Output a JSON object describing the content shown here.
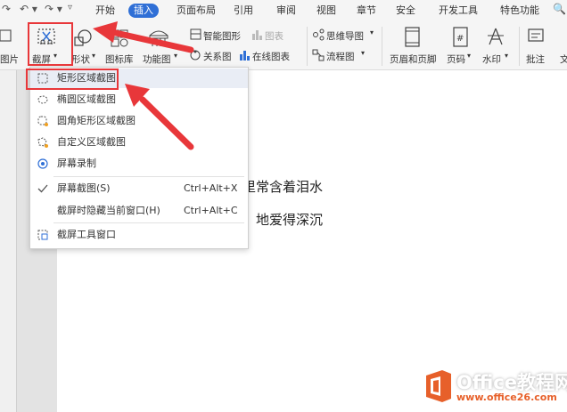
{
  "menubar": {
    "tabs": [
      "开始",
      "插入",
      "页面布局",
      "引用",
      "审阅",
      "视图",
      "章节",
      "安全",
      "开发工具",
      "特色功能"
    ],
    "active_tab": "插入"
  },
  "ribbon": {
    "pic_partial": "图片",
    "screenshot": "截屏",
    "shapes": "形状",
    "icon_lib": "图标库",
    "func_chart": "功能图",
    "smart_shape": "智能图形",
    "chart": "图表",
    "relation": "关系图",
    "online_chart": "在线图表",
    "mindmap": "思维导图",
    "flowchart": "流程图",
    "header_footer": "页眉和页脚",
    "page_number": "页码",
    "watermark": "水印",
    "comment": "批注",
    "text_partial": "文"
  },
  "dropdown": {
    "items": [
      {
        "label": "矩形区域截图",
        "shortcut": "",
        "icon": "rect-select-icon"
      },
      {
        "label": "椭圆区域截图",
        "shortcut": "",
        "icon": "ellipse-select-icon"
      },
      {
        "label": "圆角矩形区域截图",
        "shortcut": "",
        "icon": "rounded-rect-select-icon"
      },
      {
        "label": "自定义区域截图",
        "shortcut": "",
        "icon": "custom-select-icon"
      },
      {
        "label": "屏幕录制",
        "shortcut": "",
        "icon": "screen-record-icon"
      },
      {
        "label": "屏幕截图(S)",
        "shortcut": "Ctrl+Alt+X",
        "icon": "check-icon"
      },
      {
        "label": "截屏时隐藏当前窗口(H)",
        "shortcut": "Ctrl+Alt+C",
        "icon": ""
      },
      {
        "label": "截屏工具窗口",
        "shortcut": "",
        "icon": "screenshot-tool-icon"
      }
    ]
  },
  "document": {
    "line1": "里常含着泪水",
    "line2": "地爱得深沉"
  },
  "watermark": {
    "title": "Office教程网",
    "url": "www.office26.com"
  },
  "colors": {
    "accent": "#2f6fd6",
    "highlight": "#e8373a",
    "brand_orange": "#e7602a"
  }
}
